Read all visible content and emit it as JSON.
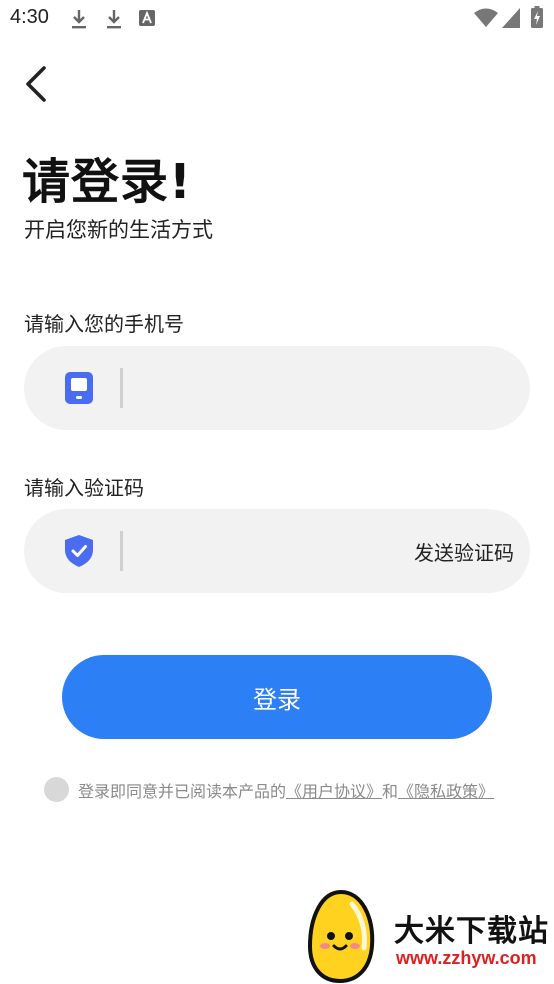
{
  "status_bar": {
    "time": "4:30",
    "icons": [
      "download-icon",
      "download-icon",
      "text-a-icon",
      "wifi-icon",
      "signal-icon",
      "battery-charging-icon"
    ]
  },
  "nav": {
    "back_icon": "chevron-left-icon"
  },
  "header": {
    "title": "请登录!",
    "subtitle": "开启您新的生活方式"
  },
  "phone": {
    "label": "请输入您的手机号",
    "icon": "phone-icon",
    "value": "",
    "placeholder": ""
  },
  "code": {
    "label": "请输入验证码",
    "icon": "shield-check-icon",
    "value": "",
    "placeholder": "",
    "send_label": "发送验证码"
  },
  "login_button": {
    "label": "登录"
  },
  "agreement": {
    "checked": false,
    "prefix": "登录即同意并已阅读本产品的",
    "terms_link": "《用户协议》",
    "and": "和",
    "privacy_link": "《隐私政策》"
  },
  "watermark": {
    "name": "大米下载站",
    "url": "www.zzhyw.com"
  },
  "colors": {
    "primary": "#2d7ff5",
    "icon_blue": "#4a6cf0",
    "field_bg": "#f2f2f2",
    "watermark_url": "#e02020"
  }
}
